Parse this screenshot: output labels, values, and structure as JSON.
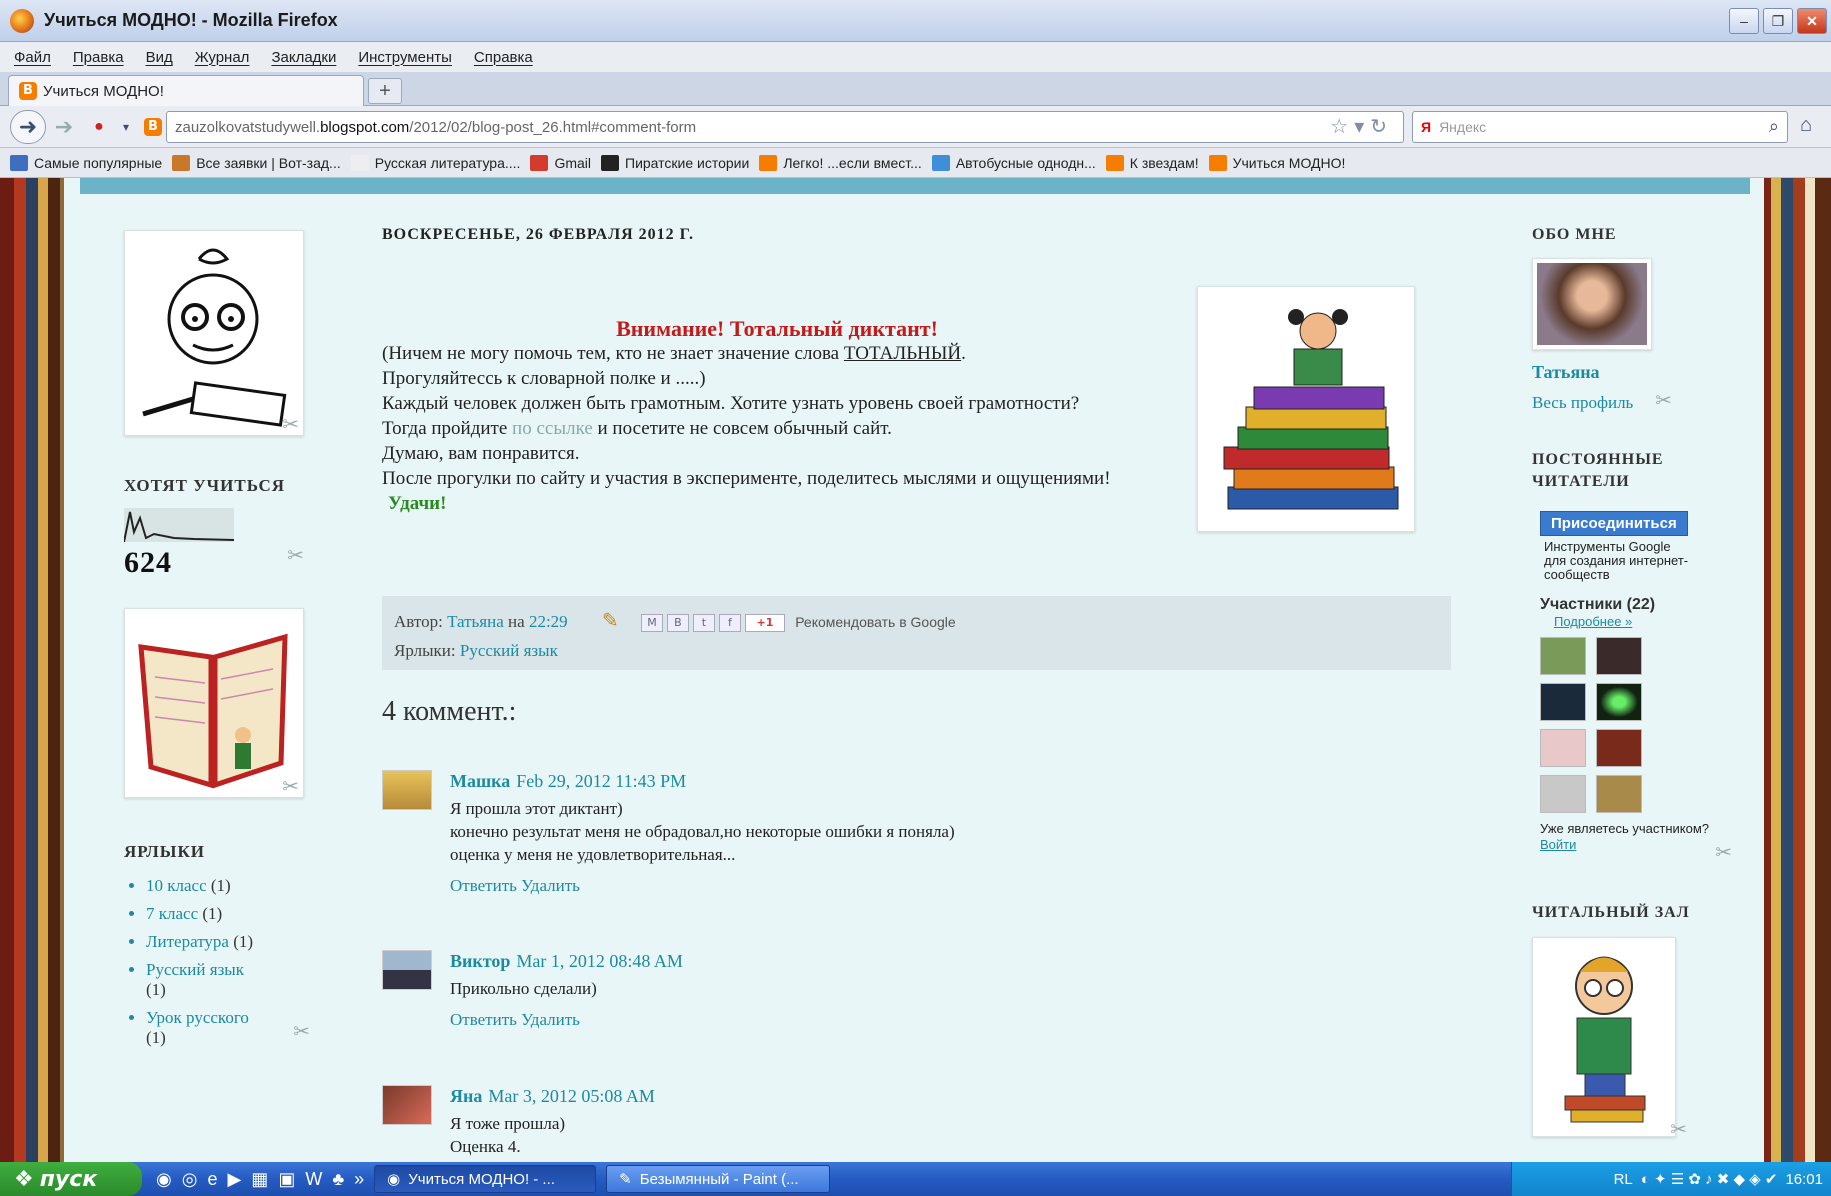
{
  "window": {
    "title": "Учиться МОДНО! - Mozilla Firefox"
  },
  "menu": [
    "Файл",
    "Правка",
    "Вид",
    "Журнал",
    "Закладки",
    "Инструменты",
    "Справка"
  ],
  "tab": {
    "label": "Учиться МОДНО!"
  },
  "nav": {
    "url_prefix": "zauzolkovatstudywell.",
    "url_domain": "blogspot.com",
    "url_path": "/2012/02/blog-post_26.html#comment-form",
    "search_placeholder": "Яндекс",
    "search_engine": "Я"
  },
  "bookmarks": [
    {
      "label": "Самые популярные",
      "color": "#3e6fbf"
    },
    {
      "label": "Все заявки | Вот-зад...",
      "color": "#c9772a"
    },
    {
      "label": "Русская литература....",
      "color": "#eeeeee"
    },
    {
      "label": "Gmail",
      "color": "#d33b2c"
    },
    {
      "label": "Пиратские истории",
      "color": "#222222"
    },
    {
      "label": "Легко! ...если вмест...",
      "color": "#f57d00"
    },
    {
      "label": "Автобусные однодн...",
      "color": "#3e8fd7"
    },
    {
      "label": "К звездам!",
      "color": "#f57d00"
    },
    {
      "label": "Учиться МОДНО!",
      "color": "#f57d00"
    }
  ],
  "left": {
    "want_heading": "ХОТЯТ УЧИТЬСЯ",
    "counter": "624",
    "labels_heading": "ЯРЛЫКИ",
    "labels": [
      {
        "name": "10 класс",
        "count": "(1)"
      },
      {
        "name": "7 класс",
        "count": "(1)"
      },
      {
        "name": "Литература",
        "count": "(1)"
      },
      {
        "name": "Русский язык",
        "count": "(1)"
      },
      {
        "name": "Урок русского",
        "count": "(1)"
      }
    ]
  },
  "post": {
    "date": "ВОСКРЕСЕНЬЕ, 26 ФЕВРАЛЯ 2012 Г.",
    "title": "Внимание! Тотальный диктант!",
    "p1a": "(Ничем не могу помочь тем, кто не знает значение слова ",
    "p1_word": "ТОТАЛЬНЫЙ",
    "p1b": ".",
    "p2": "Прогуляйтессь к словарной полке и .....)",
    "p3": "Каждый человек должен быть грамотным. Хотите узнать уровень своей грамотности?",
    "p4a": "Тогда пройдите ",
    "p4_link": "по ссылке",
    "p4b": " и посетите не совсем обычный сайт.",
    "p5": " Думаю, вам понравится.",
    "p6": "После прогулки по сайту и участия в эксперименте, поделитесь мыслями и ощущениями!",
    "luck": "Удачи!",
    "author_label": "Автор: ",
    "author": "Татьяна",
    "at": " на ",
    "time": "22:29",
    "recommend": "Рекомендовать в Google",
    "gplus": "+1",
    "labels_label": "Ярлыки: ",
    "labels_value": "Русский язык"
  },
  "comments_heading": "4 коммент.:",
  "comments": [
    {
      "author": "Машка",
      "time": "Feb 29, 2012 11:43 PM",
      "lines": [
        "Я прошла этот диктант)",
        "конечно результат меня не обрадовал,но некоторые ошибки я поняла)",
        "оценка у меня не удовлетворительная..."
      ],
      "reply": "Ответить",
      "delete": "Удалить"
    },
    {
      "author": "Виктор",
      "time": "Mar 1, 2012 08:48 AM",
      "lines": [
        "Прикольно сделали)"
      ],
      "reply": "Ответить",
      "delete": "Удалить"
    },
    {
      "author": "Яна",
      "time": "Mar 3, 2012 05:08 AM",
      "lines": [
        "Я тоже прошла)",
        "Оценка 4."
      ]
    }
  ],
  "right": {
    "about_heading": "ОБО МНЕ",
    "name": "Татьяна",
    "profile_link": "Весь профиль",
    "followers_heading": "ПОСТОЯННЫЕ ЧИТАТЕЛИ",
    "join": "Присоединиться",
    "tools_text": "Инструменты Google для создания интернет-сообществ",
    "members": "Участники (22)",
    "more": "Подробнее »",
    "already": "Уже являетесь участником?",
    "login": "Войти",
    "reading_heading": "ЧИТАЛЬНЫЙ ЗАЛ"
  },
  "taskbar": {
    "start": "пуск",
    "task1": "Учиться МОДНО! - ...",
    "task2": "Безымянный - Paint (...",
    "lang": "RL",
    "clock": "16:01"
  }
}
